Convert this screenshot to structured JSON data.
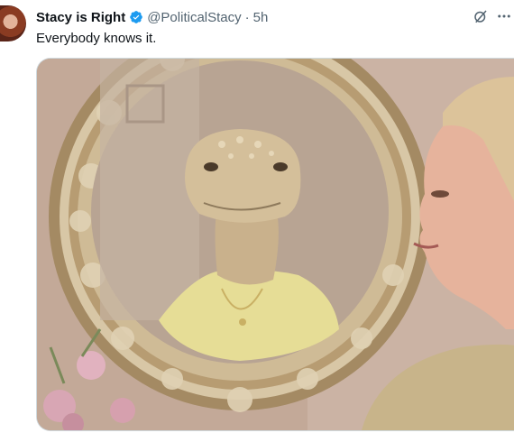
{
  "tweet": {
    "author_name": "Stacy is Right",
    "handle": "@PoliticalStacy",
    "separator": "·",
    "time": "5h",
    "text": "Everybody knows it."
  },
  "icons": {
    "verified": "verified-badge-icon",
    "grok": "grok-slash-icon",
    "more": "more-horizontal-icon"
  },
  "colors": {
    "verified_blue": "#1d9bf0",
    "secondary_text": "#536471",
    "primary_text": "#0f1419"
  }
}
